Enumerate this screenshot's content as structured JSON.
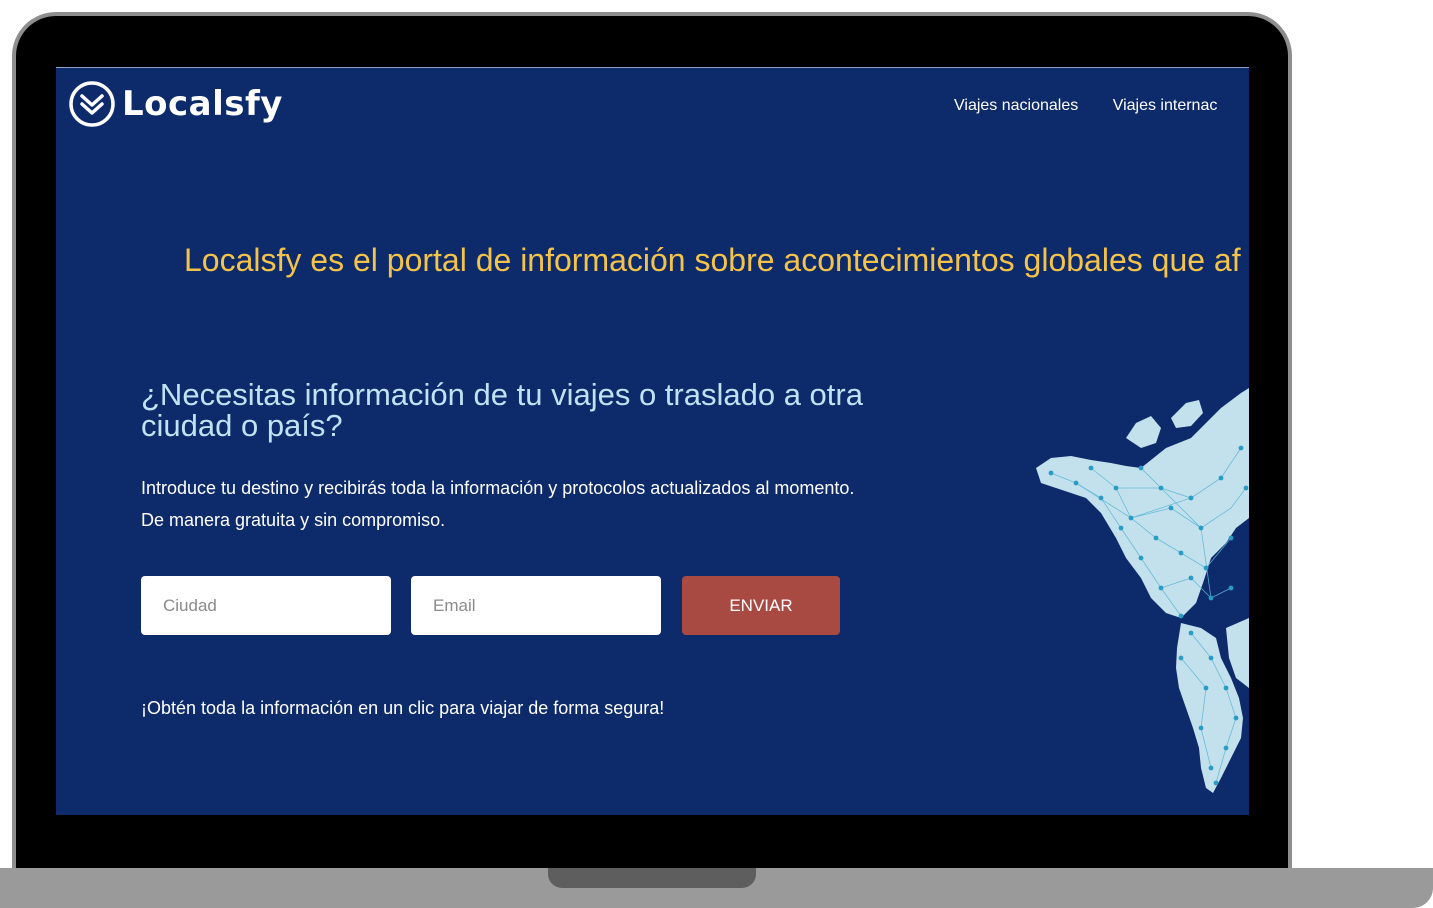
{
  "brand": {
    "name": "Localsfy"
  },
  "nav": {
    "items": [
      {
        "label": "Viajes nacionales"
      },
      {
        "label": "Viajes internac"
      }
    ]
  },
  "hero": {
    "tagline": "Localsfy es el portal de información sobre acontecimientos globales que af",
    "headline": "¿Necesitas información de tu viajes o traslado a otra ciudad o país?",
    "intro": "Introduce tu destino y recibirás toda la información y protocolos actualizados al momento. De manera gratuita y sin compromiso."
  },
  "form": {
    "city_placeholder": "Ciudad",
    "email_placeholder": "Email",
    "submit_label": "ENVIAR"
  },
  "footer_note": "¡Obtén toda la información en un clic para viajar de forma segura!",
  "colors": {
    "background": "#0d2a6b",
    "accent": "#f4c34a",
    "headline": "#bfe3f3",
    "button": "#a84a41"
  },
  "icons": {
    "logo": "chevron-badge-icon",
    "map": "world-network-map"
  }
}
